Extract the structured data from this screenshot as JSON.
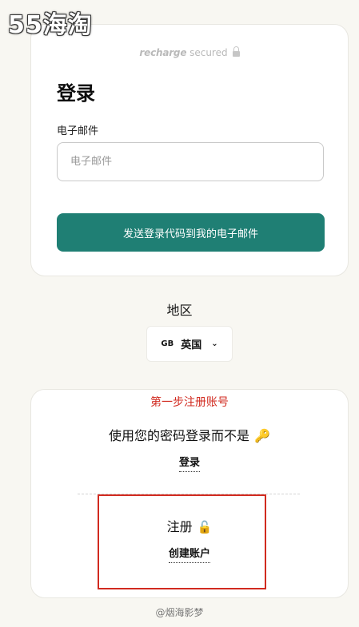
{
  "watermark": {
    "top_logo": "55海淘",
    "bottom_credit": "@烟海影梦"
  },
  "secure_badge": {
    "brand": "recharge",
    "text": " secured",
    "icon": "lock-icon"
  },
  "login": {
    "title": "登录",
    "email_label": "电子邮件",
    "email_placeholder": "电子邮件",
    "email_value": "",
    "send_button_label": "发送登录代码到我的电子邮件",
    "accent_color": "#1f7f74"
  },
  "region": {
    "title": "地区",
    "code": "GB",
    "country": "英国",
    "chevron_icon": "chevron-down-icon",
    "chevron_glyph": "⌄"
  },
  "alternate": {
    "annotation_step": "第一步注册账号",
    "password_text": "使用您的密码登录而不是",
    "key_icon": "🔑",
    "login_link": "登录",
    "register_title": "注册",
    "register_icon": "🔓",
    "create_account_link": "创建账户",
    "annotation_color": "#d12a1f"
  }
}
